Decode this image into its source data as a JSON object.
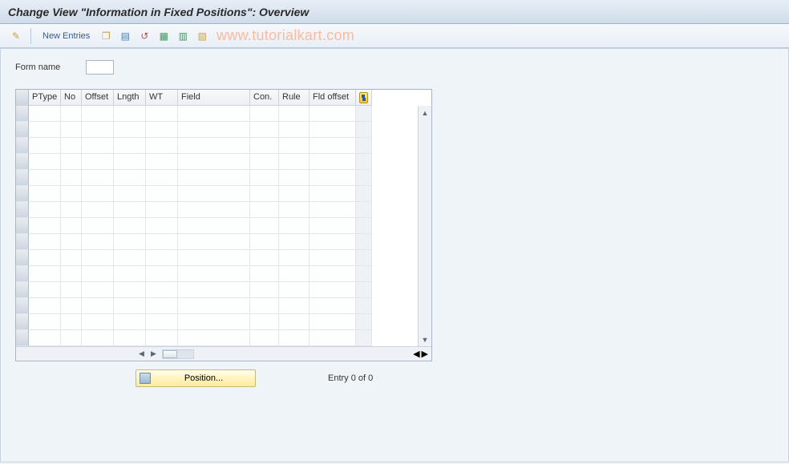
{
  "header": {
    "title": "Change View \"Information in Fixed Positions\": Overview"
  },
  "toolbar": {
    "icons": {
      "edit": "wand-icon",
      "copy": "copy-icon",
      "select": "select-all-icon",
      "undo": "undo-icon",
      "row1": "green-grid-icon-1",
      "row2": "green-grid-icon-2",
      "last": "yellow-grid-icon"
    },
    "new_entries_label": "New Entries",
    "watermark": "www.tutorialkart.com"
  },
  "form": {
    "name_label": "Form name",
    "name_value": ""
  },
  "table": {
    "columns": [
      "PType",
      "No",
      "Offset",
      "Lngth",
      "WT",
      "Field",
      "Con.",
      "Rule",
      "Fld offset"
    ],
    "rows": 15,
    "configure_title": "Configure columns"
  },
  "footer": {
    "position_label": "Position...",
    "entry_text": "Entry 0 of 0"
  }
}
